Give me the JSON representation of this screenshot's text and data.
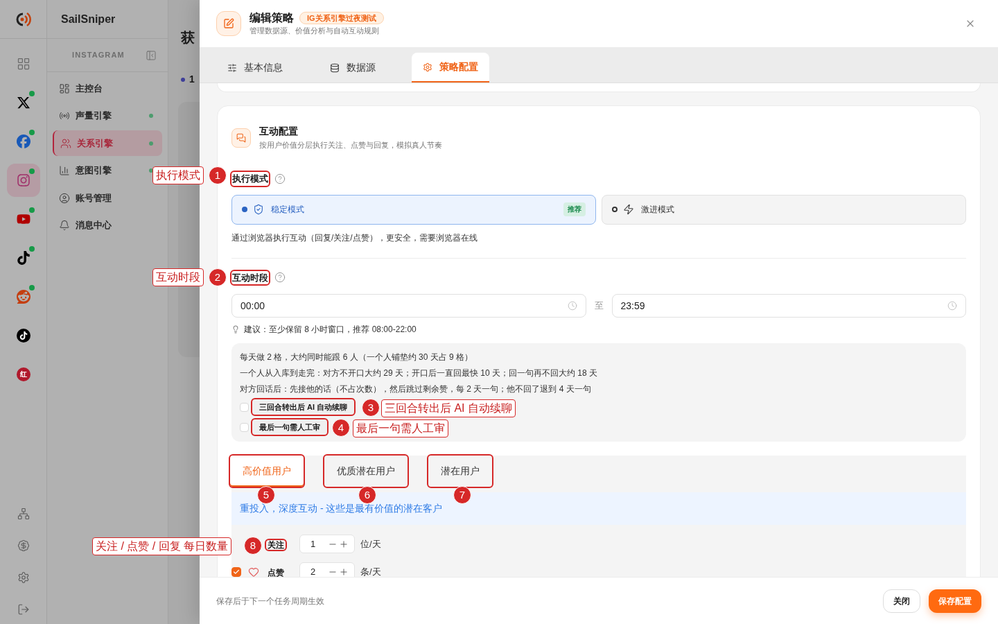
{
  "app": {
    "name": "SailSniper"
  },
  "platform_rail": [
    {
      "kind": "grid",
      "selected": false,
      "online": false
    },
    {
      "kind": "x",
      "selected": false,
      "online": true
    },
    {
      "kind": "facebook",
      "selected": false,
      "online": true
    },
    {
      "kind": "instagram",
      "selected": true,
      "online": true
    },
    {
      "kind": "youtube",
      "selected": false,
      "online": true
    },
    {
      "kind": "tiktok",
      "selected": false,
      "online": true
    },
    {
      "kind": "reddit",
      "selected": false,
      "online": true
    },
    {
      "kind": "tiktok_round",
      "selected": false,
      "online": false
    },
    {
      "kind": "xiaohongshu",
      "glyph": "红",
      "selected": false,
      "online": false
    }
  ],
  "rail_bottom": [
    {
      "kind": "network"
    },
    {
      "kind": "billing"
    },
    {
      "kind": "settings"
    },
    {
      "kind": "logout"
    }
  ],
  "sidebar": {
    "title": "INSTAGRAM",
    "items": [
      {
        "kind": "dashboard",
        "label": "主控台",
        "selected": false,
        "online": false
      },
      {
        "kind": "voice",
        "label": "声量引擎",
        "selected": false,
        "online": true
      },
      {
        "kind": "relation",
        "label": "关系引擎",
        "selected": true,
        "online": true
      },
      {
        "kind": "intent",
        "label": "意图引擎",
        "selected": false,
        "online": true
      },
      {
        "kind": "account",
        "label": "账号管理",
        "selected": false,
        "online": false
      },
      {
        "kind": "messages",
        "label": "消息中心",
        "selected": false,
        "online": false
      }
    ]
  },
  "background_page": {
    "title": "获",
    "step": "1"
  },
  "drawer": {
    "title": "编辑策略",
    "tag": "IG关系引擎过夜测试",
    "subtitle": "管理数据源、价值分析与自动互动规则",
    "tabs": [
      {
        "kind": "basic",
        "label": "基本信息",
        "selected": false
      },
      {
        "kind": "data",
        "label": "数据源",
        "selected": false
      },
      {
        "kind": "strategy",
        "label": "策略配置",
        "selected": true
      }
    ],
    "section": {
      "title": "互动配置",
      "subtitle": "按用户价值分层执行关注、点赞与回复，模拟真人节奏",
      "exec_mode": {
        "label": "执行模式",
        "options": [
          {
            "kind": "stable",
            "label": "稳定模式",
            "badge": "推荐",
            "selected": true
          },
          {
            "kind": "aggressive",
            "label": "激进模式",
            "selected": false
          }
        ],
        "description": "通过浏览器执行互动（回复/关注/点赞），更安全，需要浏览器在线"
      },
      "schedule": {
        "label": "互动时段",
        "start": "00:00",
        "separator": "至",
        "end": "23:59",
        "tip": "建议：至少保留 8 小时窗口，推荐 08:00-22:00"
      },
      "summary": {
        "lines": [
          "每天做 2 格，大约同时能跟 6 人（一个人铺垫约 30 天占 9 格）",
          "一个人从入库到走完：对方不开口大约 29 天；开口后一直回最快 10 天；回一句再不回大约 18 天",
          "对方回话后：先接他的话（不占次数），然后跳过剩余赞，每 2 天一句；他不回了退到 4 天一句"
        ],
        "options": [
          {
            "label": "三回合转出后 AI 自动续聊",
            "checked": false
          },
          {
            "label": "最后一句需人工审",
            "checked": false
          }
        ]
      },
      "tiers": {
        "tabs": [
          {
            "label": "高价值用户",
            "selected": true
          },
          {
            "label": "优质潜在用户",
            "selected": false
          },
          {
            "label": "潜在用户",
            "selected": false
          }
        ],
        "description": "重投入，深度互动 - 这些是最有价值的潜在客户",
        "actions": [
          {
            "kind": "follow",
            "label": "关注",
            "value": "1",
            "unit": "位/天"
          },
          {
            "kind": "like",
            "label": "点赞",
            "value": "2",
            "unit": "条/天",
            "checked": true
          }
        ]
      }
    },
    "footer": {
      "note": "保存后于下一个任务周期生效",
      "buttons": [
        {
          "kind": "secondary",
          "label": "关闭"
        },
        {
          "kind": "primary",
          "label": "保存配置"
        }
      ]
    }
  },
  "annotations": [
    {
      "number": "1",
      "label": "执行模式"
    },
    {
      "number": "2",
      "label": "互动时段"
    },
    {
      "number": "3",
      "label": "三回合转出后 AI 自动续聊"
    },
    {
      "number": "4",
      "label": "最后一句需人工审"
    },
    {
      "number": "5"
    },
    {
      "number": "6"
    },
    {
      "number": "7"
    },
    {
      "number": "8",
      "label": "关注 / 点赞 / 回复 每日数量"
    }
  ]
}
